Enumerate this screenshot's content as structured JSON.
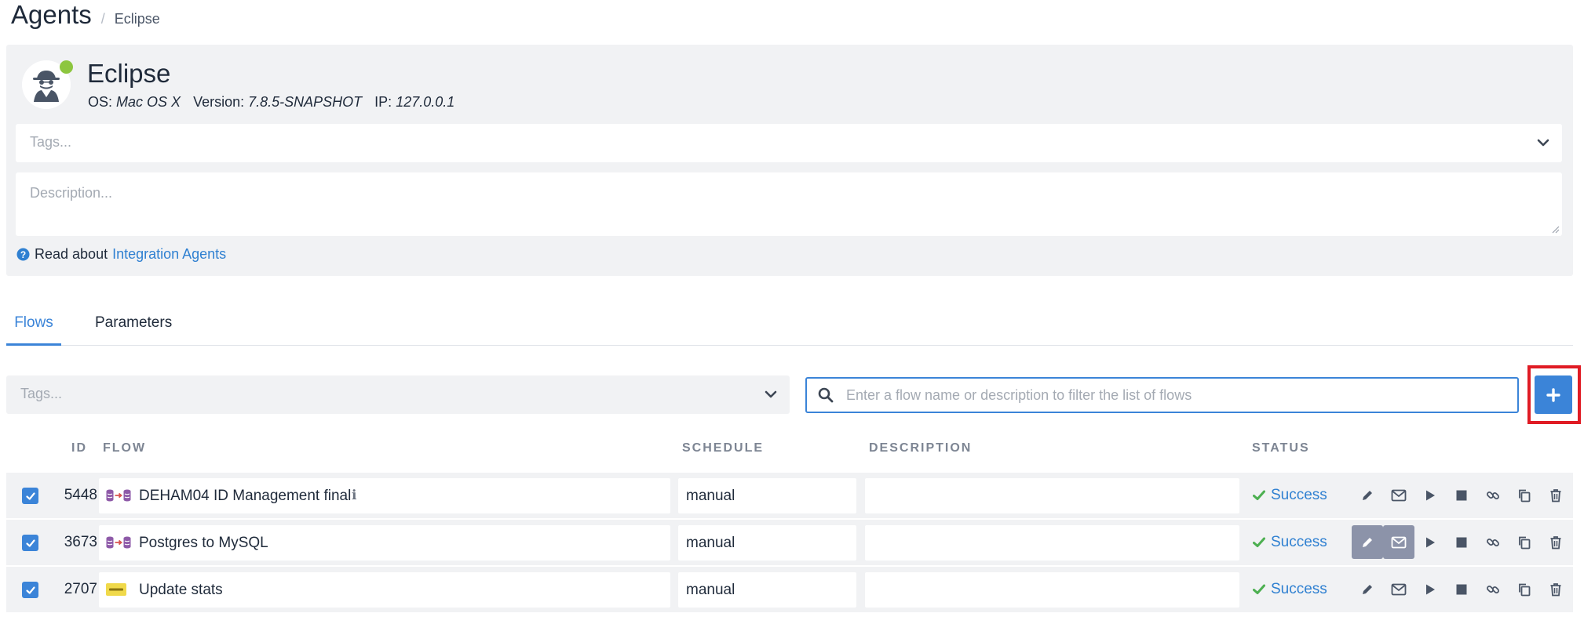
{
  "breadcrumb": {
    "title": "Agents",
    "separator": "/",
    "current": "Eclipse"
  },
  "agent": {
    "name": "Eclipse",
    "os_label": "OS:",
    "os_value": "Mac OS X",
    "version_label": "Version:",
    "version_value": "7.8.5-SNAPSHOT",
    "ip_label": "IP:",
    "ip_value": "127.0.0.1",
    "online_color": "#8dc63f",
    "tags_placeholder": "Tags...",
    "description_placeholder": "Description...",
    "read_about_prefix": "Read about",
    "read_about_link": "Integration Agents"
  },
  "tabs": [
    {
      "label": "Flows",
      "active": true
    },
    {
      "label": "Parameters",
      "active": false
    }
  ],
  "filters": {
    "tags_placeholder": "Tags...",
    "search_placeholder": "Enter a flow name or description to filter the list of flows",
    "add_label": "+"
  },
  "table": {
    "headers": {
      "id": "ID",
      "flow": "FLOW",
      "schedule": "SCHEDULE",
      "description": "DESCRIPTION",
      "status": "STATUS"
    },
    "rows": [
      {
        "id": "5448",
        "flow": "DEHAM04 ID Management final",
        "flow_icon": "db-to-db-icon",
        "has_info": true,
        "info": "ℹ",
        "schedule": "manual",
        "description": "",
        "status": "Success",
        "checked": true
      },
      {
        "id": "3673",
        "flow": "Postgres to MySQL",
        "flow_icon": "db-to-db-icon",
        "has_info": false,
        "schedule": "manual",
        "description": "",
        "status": "Success",
        "checked": true
      },
      {
        "id": "2707",
        "flow": "Update stats",
        "flow_icon": "script-icon",
        "has_info": false,
        "schedule": "manual",
        "description": "",
        "status": "Success",
        "checked": true
      }
    ]
  },
  "colors": {
    "accent": "#3b84d8",
    "panel": "#f1f2f4",
    "highlight": "#e01b24",
    "success_check": "#4caf50"
  }
}
